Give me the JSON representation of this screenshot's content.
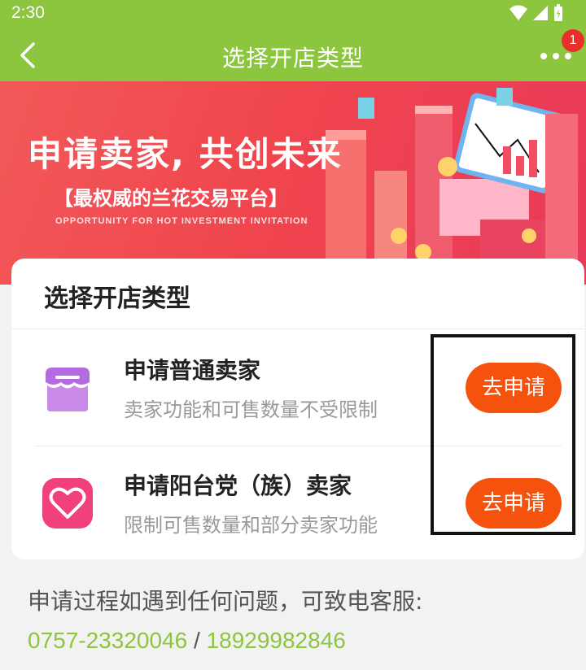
{
  "status_bar": {
    "time": "2:30"
  },
  "nav": {
    "title": "选择开店类型",
    "badge_count": "1"
  },
  "banner": {
    "headline": "申请卖家, 共创未来",
    "subtitle": "【最权威的兰花交易平台】",
    "english": "OPPORTUNITY FOR HOT INVESTMENT INVITATION"
  },
  "card": {
    "title": "选择开店类型",
    "options": [
      {
        "title": "申请普通卖家",
        "description": "卖家功能和可售数量不受限制",
        "button": "去申请",
        "icon": "shop-icon",
        "icon_color": "#b56be0"
      },
      {
        "title": "申请阳台党（族）卖家",
        "description": "限制可售数量和部分卖家功能",
        "button": "去申请",
        "icon": "heart-icon",
        "icon_color": "#f0407e"
      }
    ]
  },
  "footer": {
    "help_text": "申请过程如遇到任何问题，可致电客服:",
    "phone_1": "0757-23320046",
    "separator": " / ",
    "phone_2": "18929982846"
  },
  "colors": {
    "primary_green": "#8cc63e",
    "button_orange": "#f4520d",
    "banner_red": "#f0454d"
  }
}
